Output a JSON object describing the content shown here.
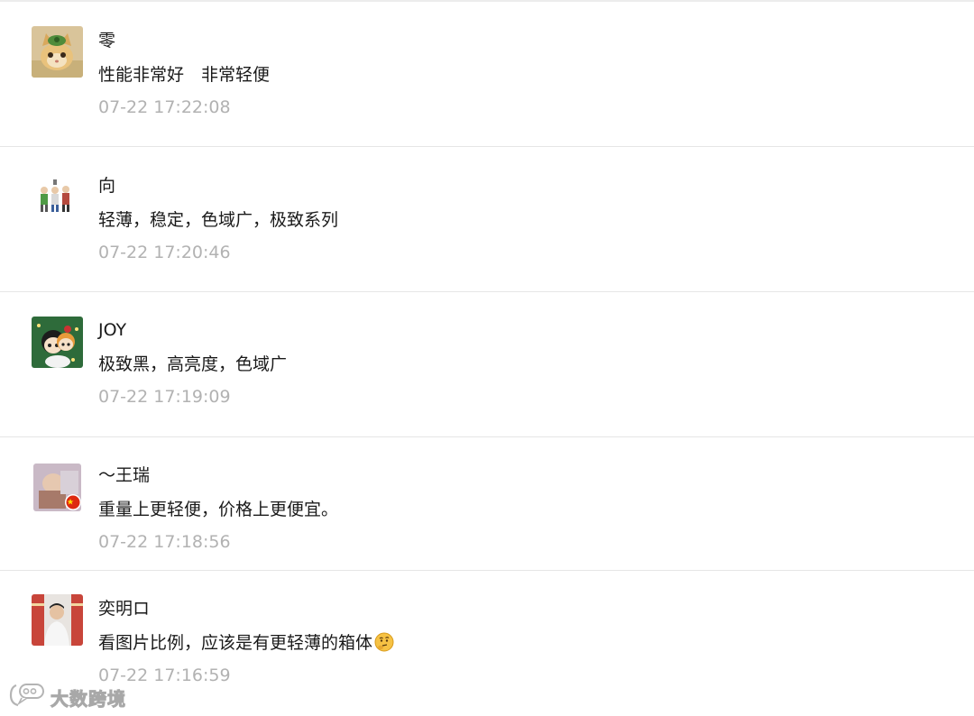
{
  "comments": [
    {
      "name": "零",
      "text": "性能非常好　非常轻便",
      "time": "07-22 17:22:08"
    },
    {
      "name": "向",
      "text": "轻薄，稳定，色域广，极致系列",
      "time": "07-22 17:20:46"
    },
    {
      "name": "JOY",
      "text": "极致黑，高亮度，色域广",
      "time": "07-22 17:19:09"
    },
    {
      "name": "～王瑞",
      "text": "重量上更轻便，价格上更便宜。",
      "time": "07-22 17:18:56"
    },
    {
      "name": "奕明ロ",
      "text": "看图片比例，应该是有更轻薄的箱体",
      "time": "07-22 17:16:59"
    }
  ],
  "watermark": {
    "text": "大数跨境"
  },
  "icons": {
    "comment_5_emoji": "thinking-face-icon",
    "watermark_logo": "chat-bubble-logo-icon"
  }
}
